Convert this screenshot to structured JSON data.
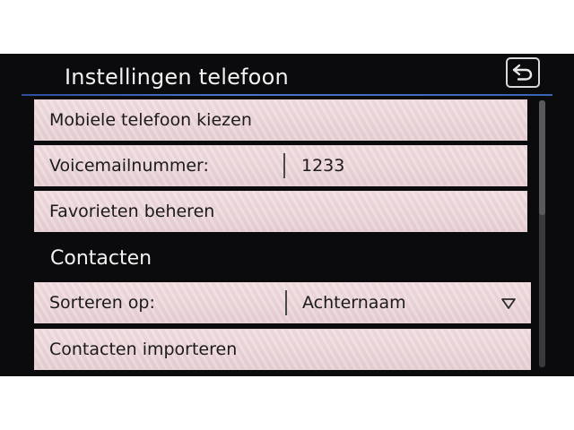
{
  "header": {
    "title": "Instellingen telefoon"
  },
  "icons": {
    "back": "back-arrow-icon",
    "dropdown": "triangle-down-icon"
  },
  "colors": {
    "title_line": "#3a64b4",
    "row_background": "#ecd7db",
    "screen_background": "#0b0b0d"
  },
  "settings": {
    "select_phone": {
      "label": "Mobiele telefoon kiezen"
    },
    "voicemail": {
      "label": "Voicemailnummer:",
      "value": "1233"
    },
    "favorites": {
      "label": "Favorieten beheren"
    }
  },
  "contacts": {
    "heading": "Contacten",
    "sort": {
      "label": "Sorteren op:",
      "value": "Achternaam"
    },
    "import": {
      "label": "Contacten importeren"
    }
  }
}
